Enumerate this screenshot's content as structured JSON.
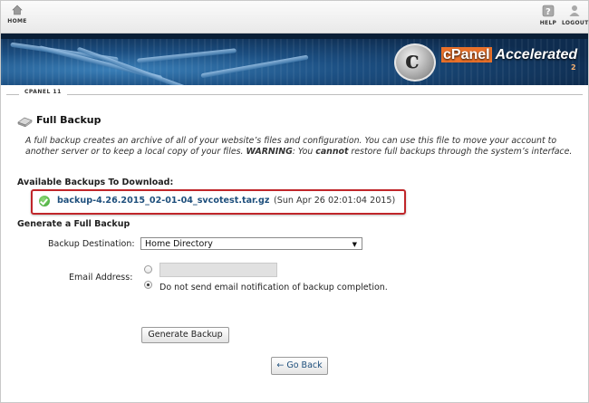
{
  "toolbar": {
    "home_label": "HOME",
    "help_label": "HELP",
    "logout_label": "LOGOUT"
  },
  "banner": {
    "brand": "cPanel",
    "accelerated": "Accelerated",
    "superscript": "2"
  },
  "tab": {
    "label": "CPANEL 11"
  },
  "page": {
    "title": "Full Backup",
    "desc_part1": "A full backup creates an archive of all of your website’s files and configuration. You can use this file to move your account to another server or to keep a local copy of your files. ",
    "desc_warning": "WARNING",
    "desc_part2": ": You ",
    "desc_cannot": "cannot",
    "desc_part3": " restore full backups through the system’s interface."
  },
  "available": {
    "heading": "Available Backups To Download:",
    "backup_file": "backup-4.26.2015_02-01-04_svcotest.tar.gz",
    "backup_date": "(Sun Apr 26 02:01:04 2015)"
  },
  "generate": {
    "heading": "Generate a Full Backup",
    "destination_label": "Backup Destination:",
    "destination_value": "Home Directory",
    "email_label": "Email Address:",
    "email_value": "",
    "no_email_label": "Do not send email notification of backup completion.",
    "generate_button": "Generate Backup",
    "back_button": "← Go Back"
  },
  "colors": {
    "link": "#1e4f7c",
    "highlight_border": "#c0262a",
    "banner": "#123a63",
    "brand_orange": "#e9712a"
  },
  "icons": {
    "home": "home-icon",
    "help": "help-icon",
    "logout": "logout-icon",
    "title": "hard-drive-icon",
    "check": "checkmark-icon"
  }
}
